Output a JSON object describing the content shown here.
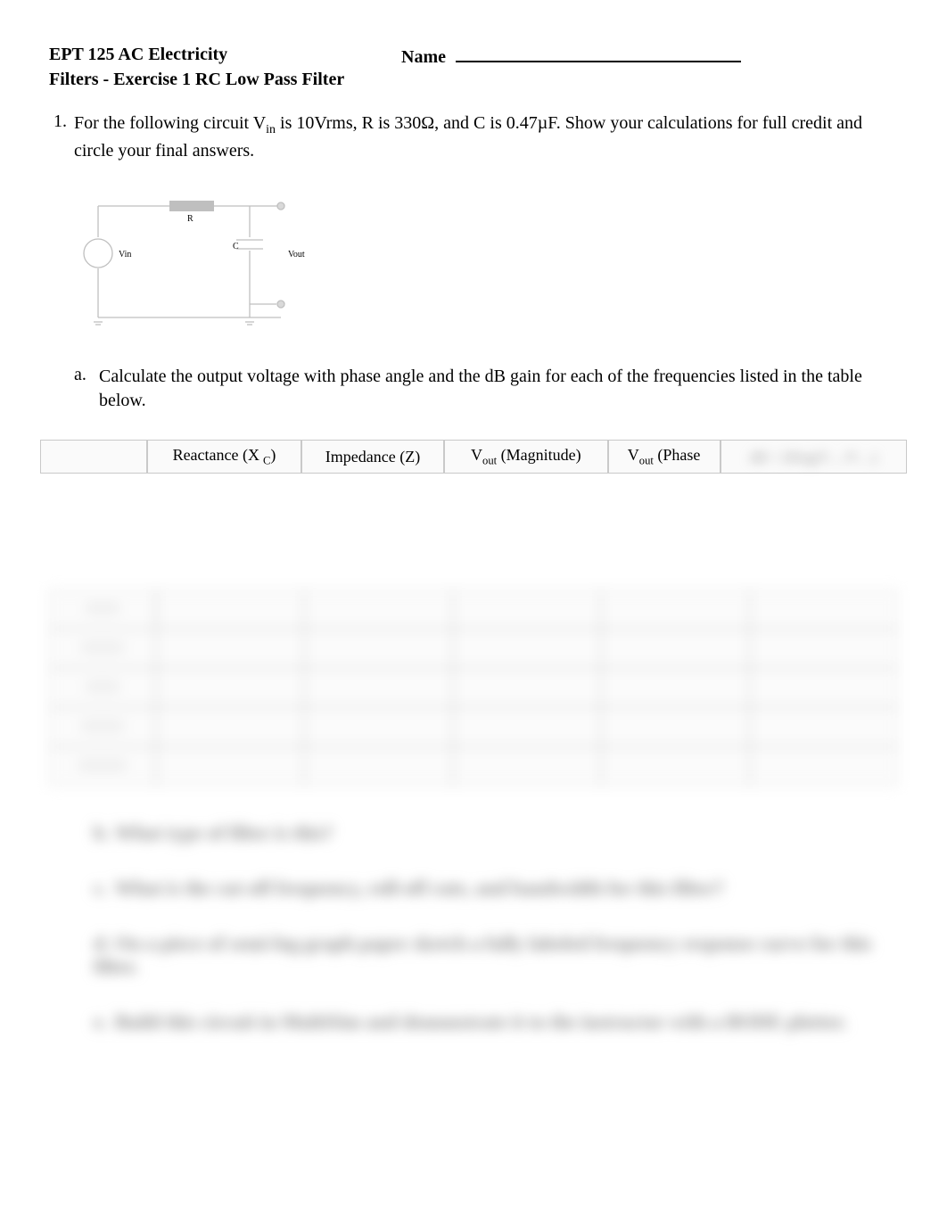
{
  "header": {
    "course": "EPT 125 AC Electricity",
    "name_label": "Name",
    "subtitle": "Filters - Exercise 1 RC Low Pass Filter"
  },
  "q1": {
    "number": "1.",
    "text_before_sub": "For the following circuit V",
    "vin_sub": "in",
    "text_after_vin": " is 10Vrms, R is 330Ω, and C is 0.47µF. Show your calculations for full credit and circle your final answers."
  },
  "circuit": {
    "label_R": "R",
    "label_C": "C",
    "label_Vin": "Vin",
    "label_Vout": "Vout"
  },
  "sub_a": {
    "letter": "a.",
    "text": "Calculate the output voltage with phase angle and the dB gain for each of the frequencies listed in the table below."
  },
  "table": {
    "headers": {
      "col1": "",
      "reactance_pre": "Reactance (X",
      "reactance_sub": "C",
      "reactance_post": ")",
      "impedance": "Impedance (Z)",
      "vout_mag_pre": "V",
      "vout_mag_sub": "out",
      "vout_mag_post": " (Magnitude)",
      "vout_phase_pre": "V",
      "vout_phase_sub": "out",
      "vout_phase_post": " (Phase",
      "db_blur": "dB = 20log(V…/V…)"
    }
  },
  "blurred": {
    "q_b": "What type of filter is this?",
    "q_c": "What is the cut-off frequency, roll-off rate, and bandwidth for this filter?",
    "q_d": "On a piece of semi-log graph paper sketch a fully labeled frequency response curve for this filter.",
    "q_e": "Build this circuit in MultiSim and demonstrate it to the instructor with a BODE plotter."
  }
}
